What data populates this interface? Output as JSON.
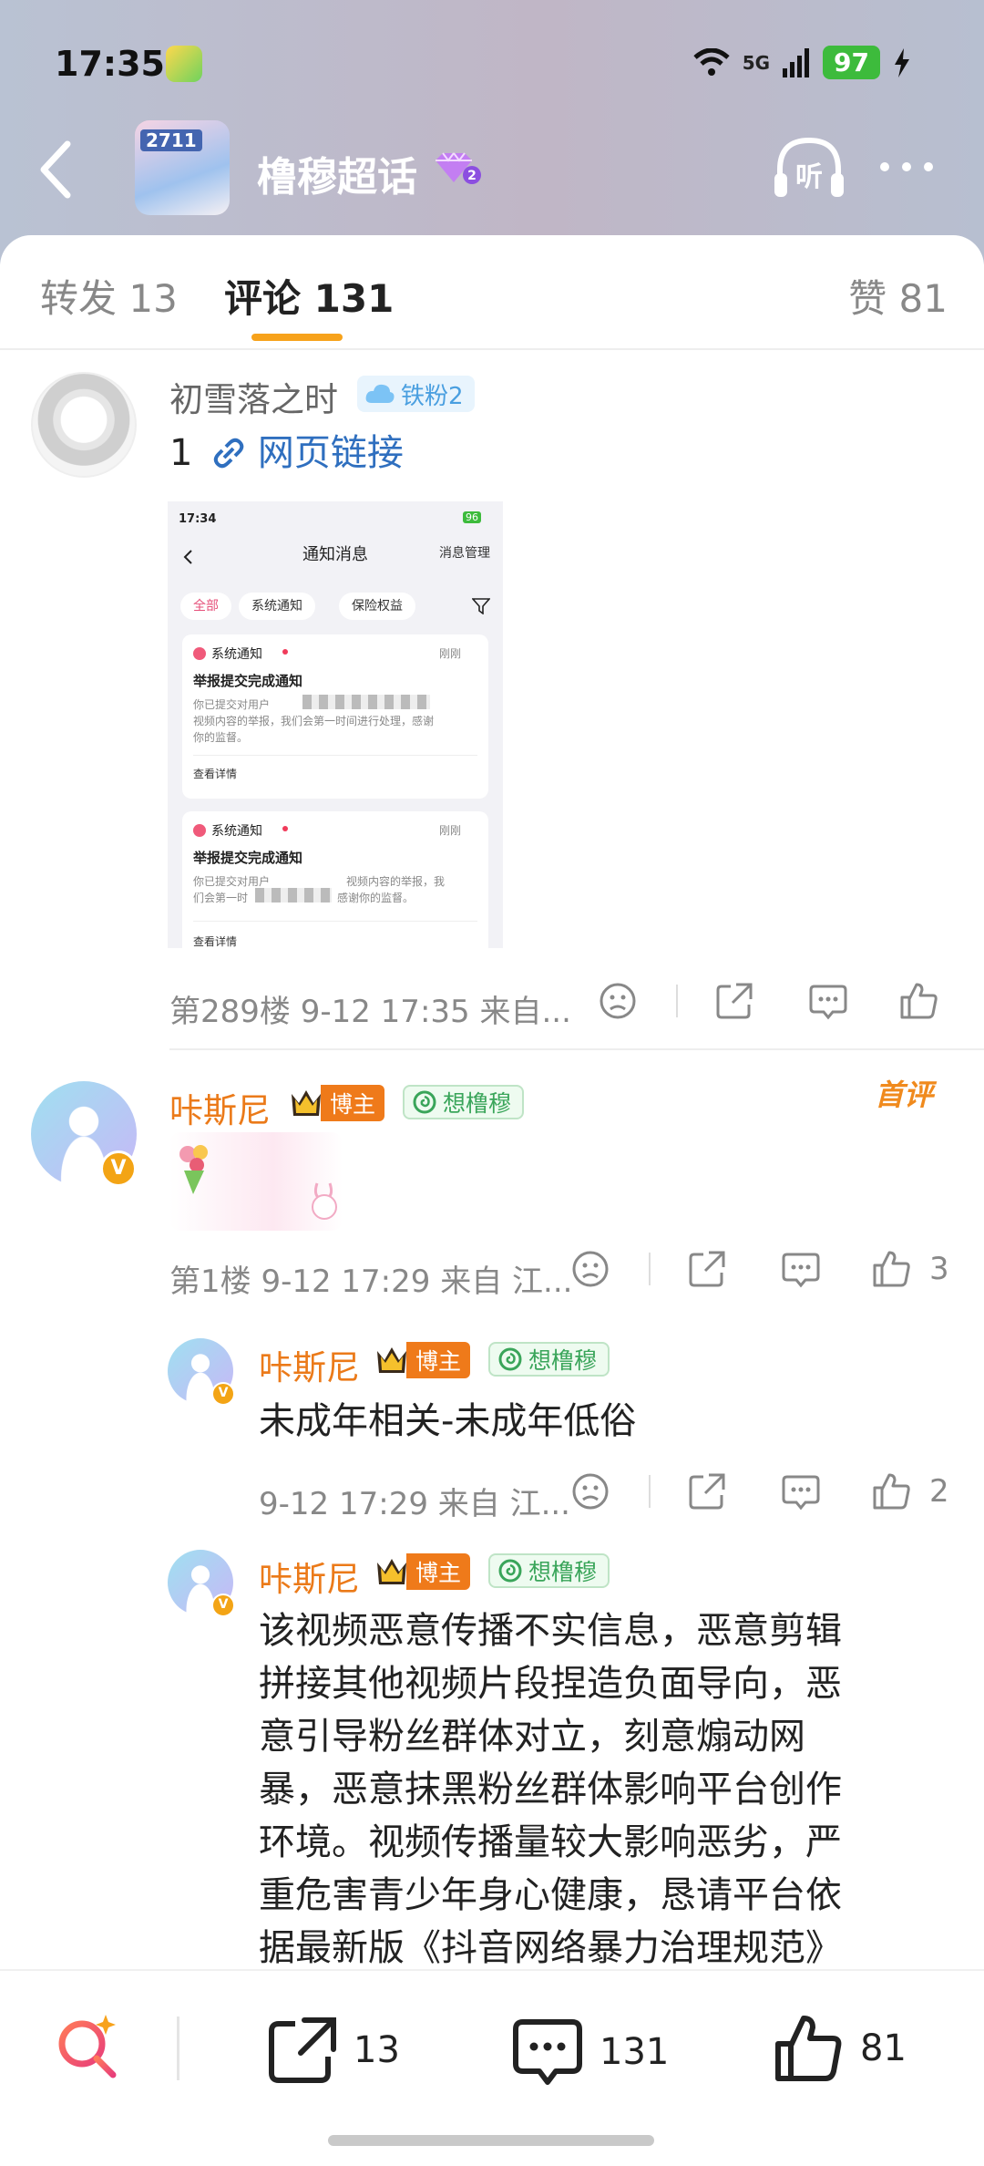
{
  "status": {
    "time": "17:35",
    "network": "5G",
    "battery": "97"
  },
  "topic": {
    "title": "橹穆超话",
    "avatar_tag": "2711",
    "listen_label": "听",
    "level": "2"
  },
  "tabs": {
    "forward": "转发 13",
    "comment": "评论 131",
    "like": "赞 81"
  },
  "comments": [
    {
      "user": "初雪落之时",
      "fan_badge": "铁粉2",
      "text_prefix": "1",
      "link_text": "网页链接",
      "floor_meta": "第289楼 9-12 17:35 来自...",
      "screenshot": {
        "time": "17:34",
        "battery": "96",
        "title": "通知消息",
        "manage": "消息管理",
        "chips": [
          "全部",
          "系统通知",
          "保险权益"
        ],
        "cards": [
          {
            "label": "系统通知",
            "tag": "刚刚",
            "title": "举报提交完成通知",
            "lines": [
              "你已提交对用户",
              "视频内容的举报，我们会第一时间进行处理，感谢",
              "你的监督。"
            ],
            "more": "查看详情"
          },
          {
            "label": "系统通知",
            "tag": "刚刚",
            "title": "举报提交完成通知",
            "lines": [
              "你已提交对用户",
              "视频内容的举报，我",
              "们会第一时",
              "感谢你的监督。"
            ],
            "more": "查看详情"
          }
        ]
      }
    },
    {
      "user": "咔斯尼",
      "badge": "博主",
      "tag": "想橹穆",
      "first_label": "首评",
      "floor_meta": "第1楼 9-12 17:29 来自 江...",
      "likes": "3"
    }
  ],
  "replies": [
    {
      "user": "咔斯尼",
      "badge": "博主",
      "tag": "想橹穆",
      "text": "未成年相关-未成年低俗",
      "meta": "9-12 17:29 来自 江...",
      "likes": "2"
    },
    {
      "user": "咔斯尼",
      "badge": "博主",
      "tag": "想橹穆",
      "lines": [
        "该视频恶意传播不实信息，恶意剪辑",
        "拼接其他视频片段捏造负面导向，恶",
        "意引导粉丝群体对立，刻意煽动网",
        "暴，恶意抹黑粉丝群体影响平台创作",
        "环境。视频传播量较大影响恶劣，严",
        "重危害青少年身心健康，恳请平台依",
        "据最新版《抖音网络暴力治理规范》"
      ]
    }
  ],
  "bottom": {
    "forward": "13",
    "comment": "131",
    "like": "81"
  },
  "colors": {
    "accent": "#f7a21b",
    "blogger": "#ef7a1a",
    "link": "#2f6fbf"
  }
}
